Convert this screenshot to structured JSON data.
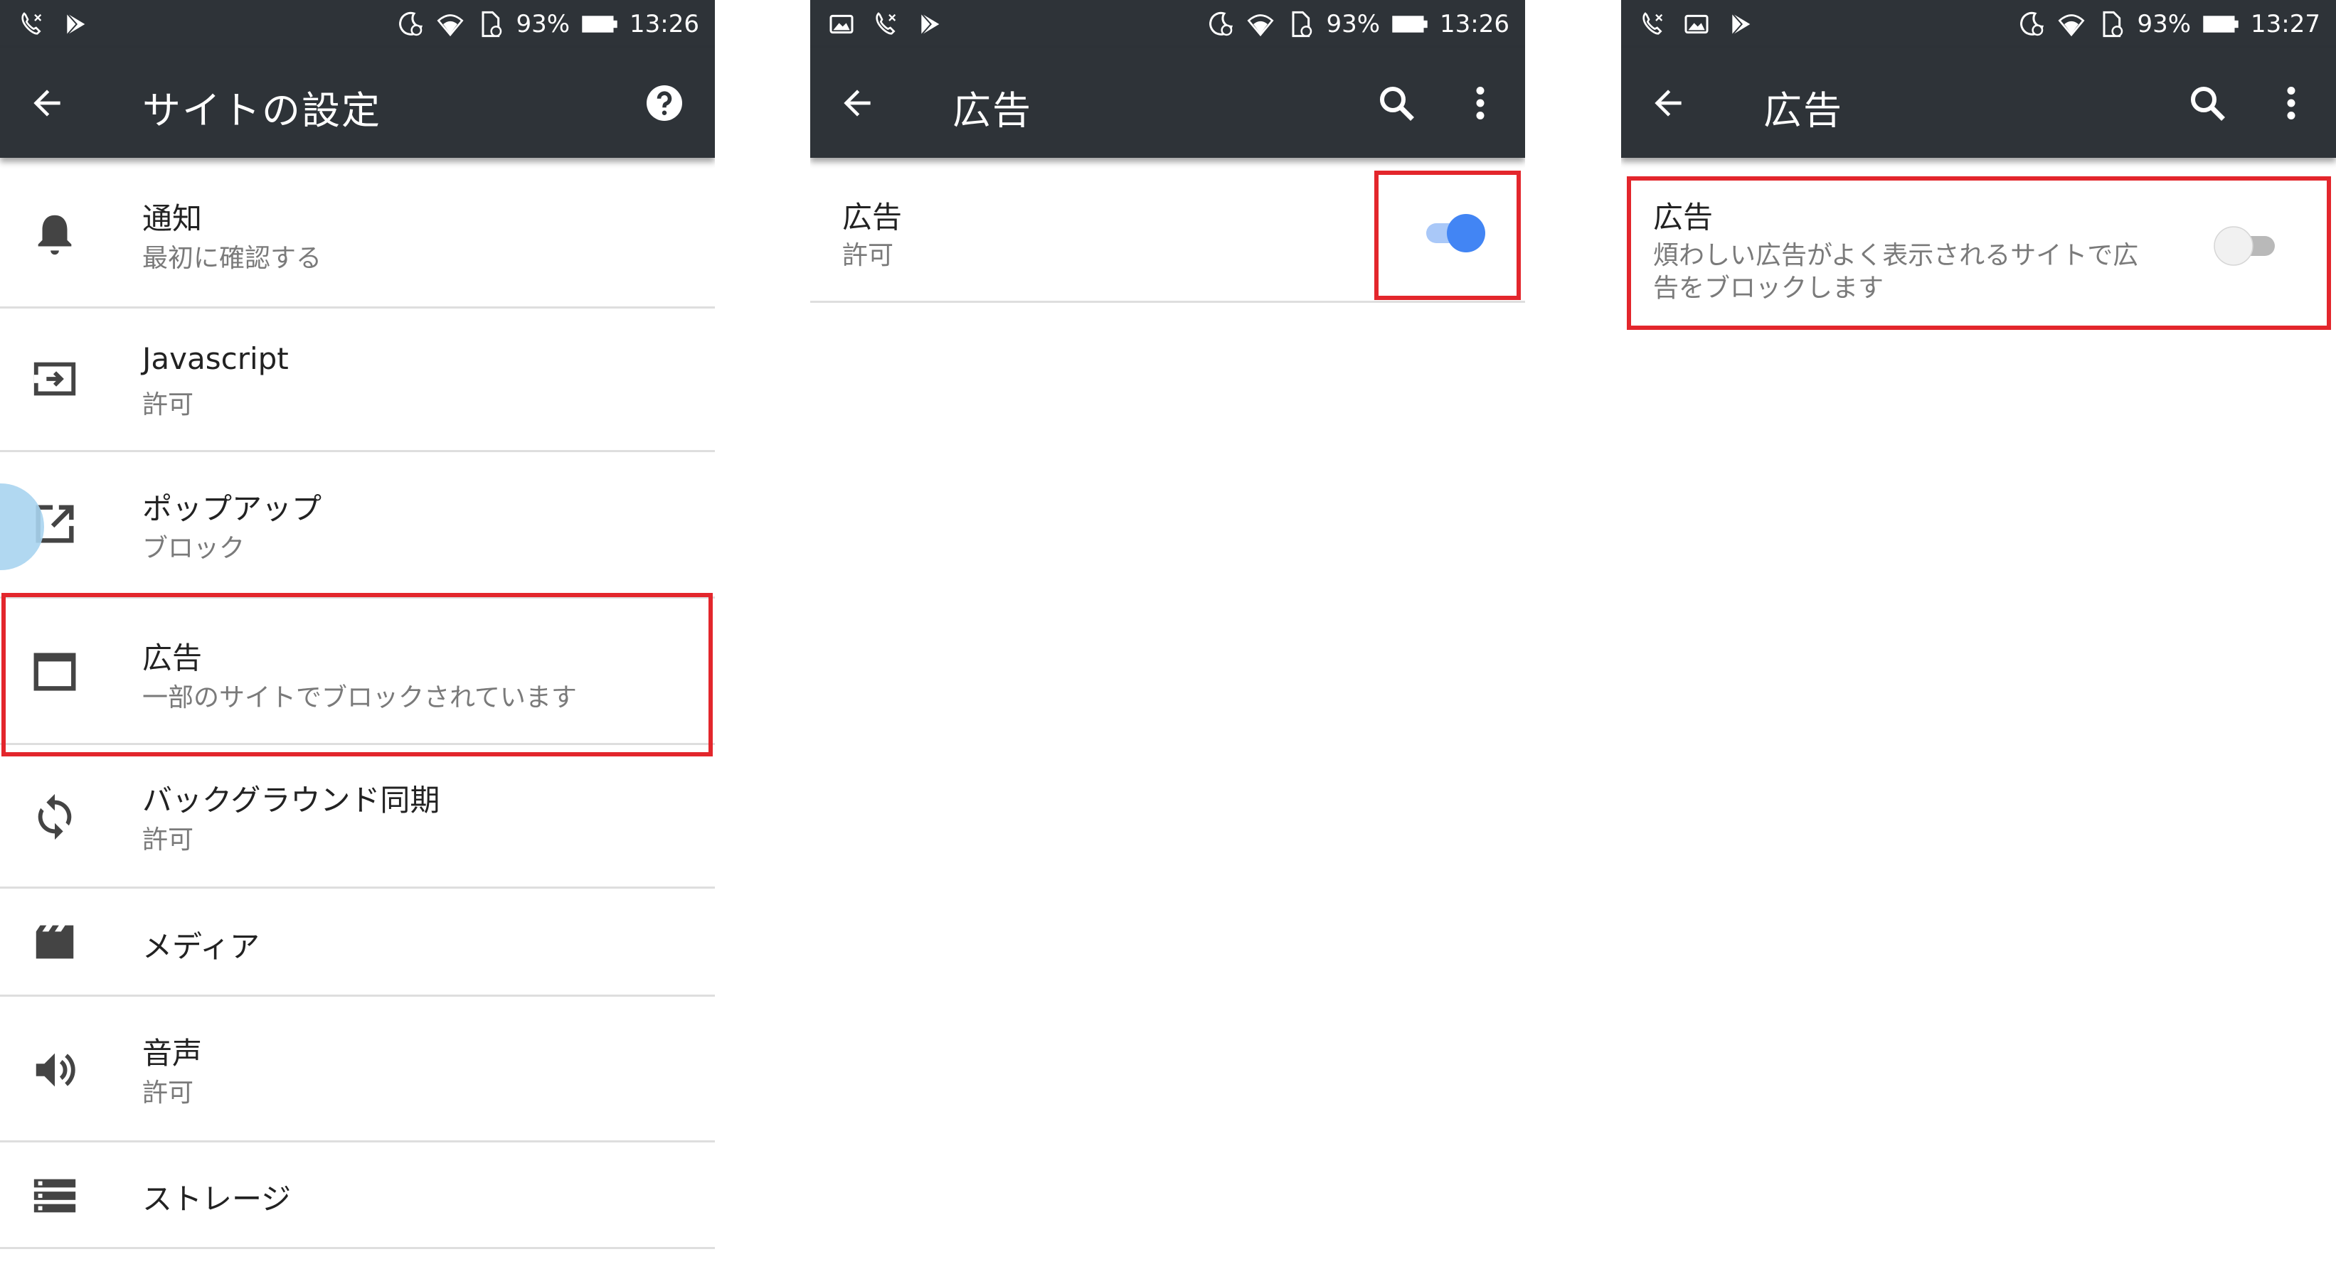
{
  "colors": {
    "bar": "#2e3338",
    "highlight": "#e3262c",
    "toggle_on": "#4285f4",
    "toggle_on_track": "#a9c8f8",
    "toggle_off_thumb": "#f1f1f1",
    "toggle_off_track": "#b9b9b9"
  },
  "screen1": {
    "status": {
      "icons": [
        "phone-missed-icon",
        "play-store-icon",
        "alarm-icon",
        "wifi-icon",
        "sim-icon",
        "battery-icon"
      ],
      "battery": "93%",
      "time": "13:26"
    },
    "appbar": {
      "title": "サイトの設定",
      "back_icon": "back-arrow-icon",
      "help_icon": "help-icon"
    },
    "items": [
      {
        "icon": "bell-icon",
        "title": "通知",
        "subtitle": "最初に確認する"
      },
      {
        "icon": "javascript-icon",
        "title": "Javascript",
        "subtitle": "許可"
      },
      {
        "icon": "popup-icon",
        "title": "ポップアップ",
        "subtitle": "ブロック"
      },
      {
        "icon": "ads-icon",
        "title": "広告",
        "subtitle": "一部のサイトでブロックされています",
        "highlighted": true
      },
      {
        "icon": "sync-icon",
        "title": "バックグラウンド同期",
        "subtitle": "許可"
      },
      {
        "icon": "media-icon",
        "title": "メディア",
        "subtitle": ""
      },
      {
        "icon": "sound-icon",
        "title": "音声",
        "subtitle": "許可"
      },
      {
        "icon": "storage-icon",
        "title": "ストレージ",
        "subtitle": ""
      }
    ]
  },
  "screen2": {
    "status": {
      "icons": [
        "image-icon",
        "phone-missed-icon",
        "play-store-icon",
        "alarm-icon",
        "wifi-icon",
        "sim-icon",
        "battery-icon"
      ],
      "battery": "93%",
      "time": "13:26"
    },
    "appbar": {
      "title": "広告",
      "back_icon": "back-arrow-icon",
      "search_icon": "search-icon",
      "more_icon": "more-vert-icon"
    },
    "item": {
      "title": "広告",
      "subtitle": "許可",
      "toggle_on": true
    }
  },
  "screen3": {
    "status": {
      "icons": [
        "phone-missed-icon",
        "image-icon",
        "play-store-icon",
        "alarm-icon",
        "wifi-icon",
        "sim-icon",
        "battery-icon"
      ],
      "battery": "93%",
      "time": "13:27"
    },
    "appbar": {
      "title": "広告",
      "back_icon": "back-arrow-icon",
      "search_icon": "search-icon",
      "more_icon": "more-vert-icon"
    },
    "item": {
      "title": "広告",
      "subtitle_line1": "煩わしい広告がよく表示されるサイトで広",
      "subtitle_line2": "告をブロックします",
      "toggle_on": false
    }
  }
}
